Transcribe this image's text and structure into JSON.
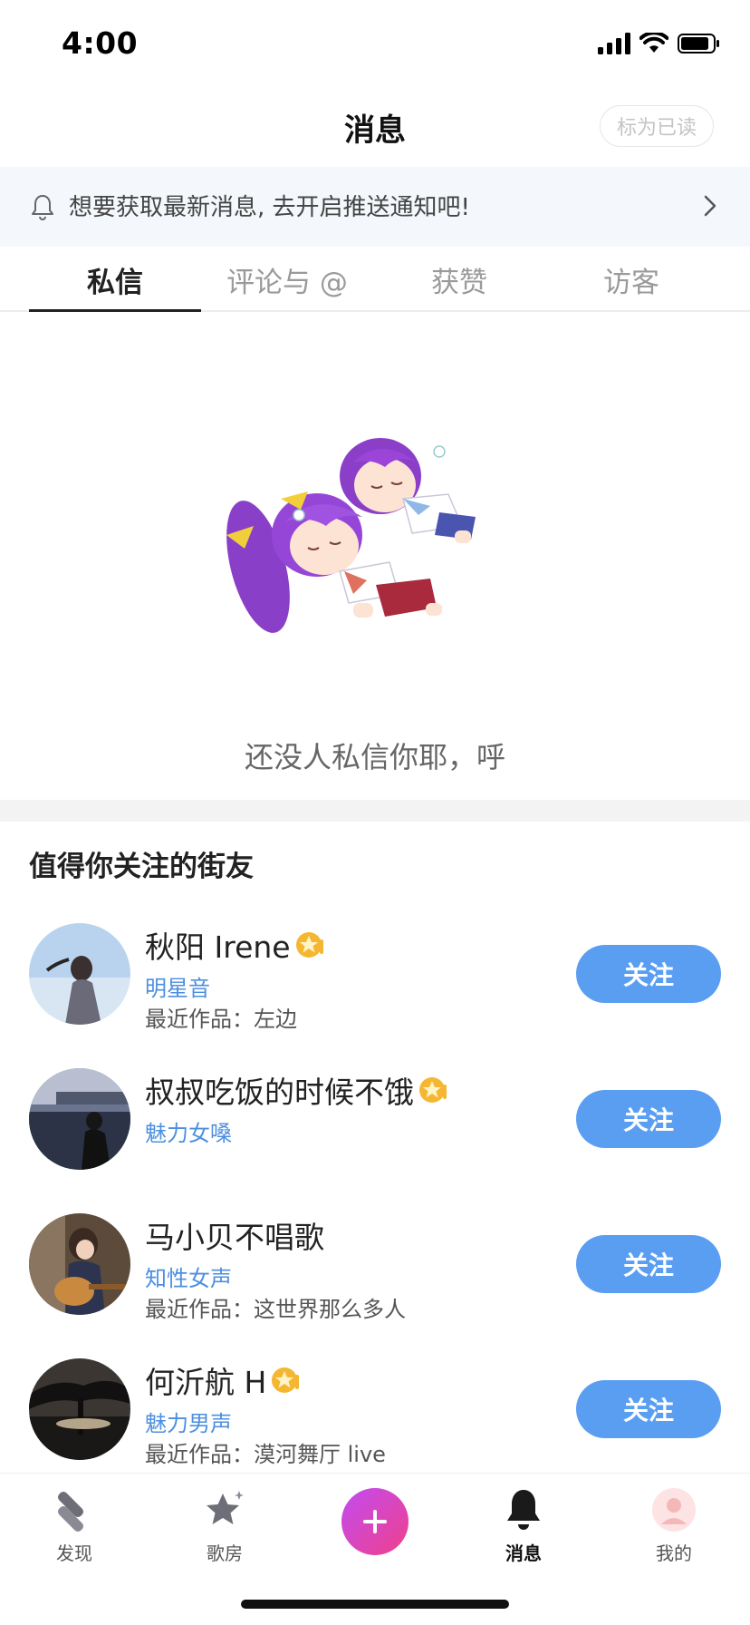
{
  "status_bar": {
    "time": "4:00"
  },
  "header": {
    "title": "消息",
    "mark_read_label": "标为已读"
  },
  "notify_banner": {
    "text": "想要获取最新消息, 去开启推送通知吧!"
  },
  "tabs": [
    {
      "label": "私信",
      "active": true
    },
    {
      "label": "评论与 @",
      "active": false
    },
    {
      "label": "获赞",
      "active": false
    },
    {
      "label": "访客",
      "active": false
    }
  ],
  "empty_state": {
    "text": "还没人私信你耶，呼"
  },
  "recommend": {
    "title": "值得你关注的街友",
    "follow_label": "关注",
    "users": [
      {
        "name": "秋阳 Irene",
        "tag": "明星音",
        "work": "最近作品：左边",
        "badge": true
      },
      {
        "name": "叔叔吃饭的时候不饿",
        "tag": "魅力女嗓",
        "work": "",
        "badge": true
      },
      {
        "name": "马小贝不唱歌",
        "tag": "知性女声",
        "work": "最近作品：这世界那么多人",
        "badge": false
      },
      {
        "name": "何沂航 H",
        "tag": "魅力男声",
        "work": "最近作品：漠河舞厅 live",
        "badge": true
      }
    ]
  },
  "tabbar": {
    "items": [
      {
        "label": "发现",
        "icon": "discover-icon"
      },
      {
        "label": "歌房",
        "icon": "star-room-icon"
      },
      {
        "label": "",
        "icon": "plus-icon"
      },
      {
        "label": "消息",
        "icon": "bell-icon"
      },
      {
        "label": "我的",
        "icon": "profile-icon"
      }
    ]
  },
  "colors": {
    "accent": "#5a9ef2",
    "tag_blue": "#4c8fe0",
    "banner_bg": "#f4f7fb",
    "create_gradient_start": "#c14cf2",
    "create_gradient_end": "#f0408a"
  }
}
